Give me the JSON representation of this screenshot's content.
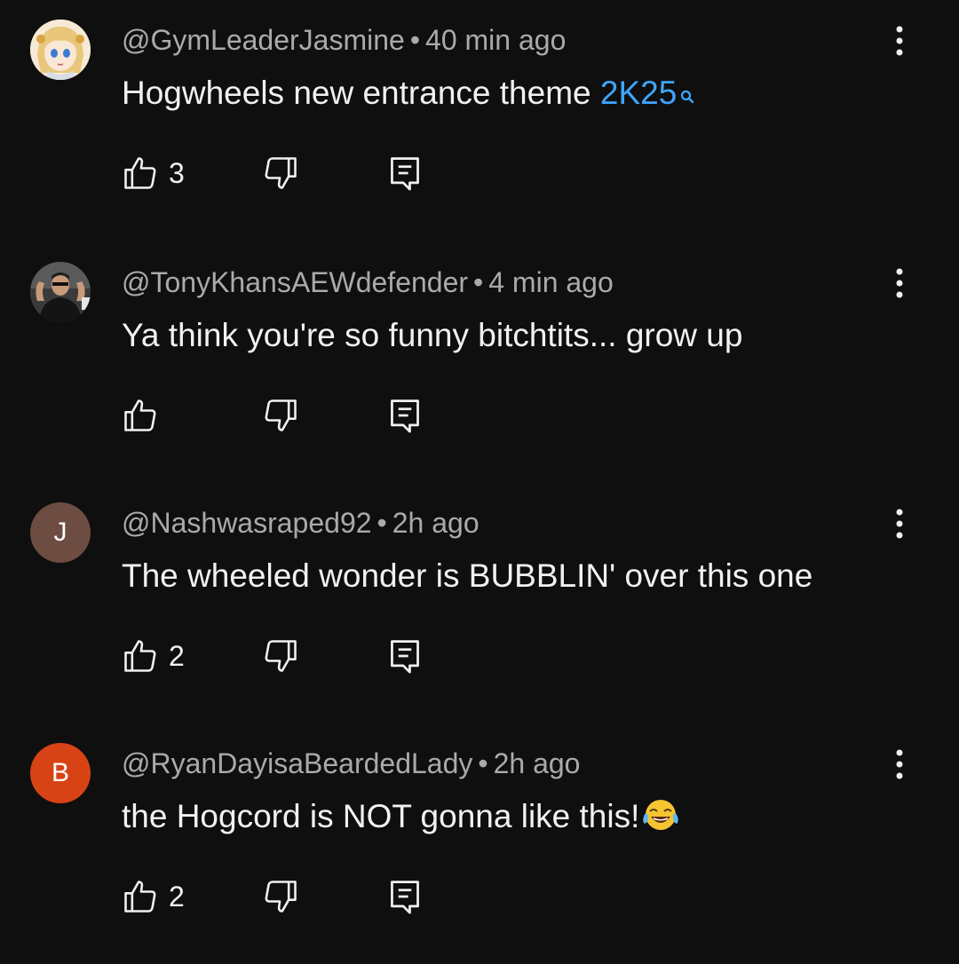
{
  "comments": [
    {
      "handle": "@GymLeaderJasmine",
      "time": "40 min ago",
      "text": "Hogwheels new entrance theme ",
      "link_text": "2K25",
      "likes": "3",
      "avatar": {
        "type": "image",
        "description_icon": "anime-girl-avatar"
      }
    },
    {
      "handle": "@TonyKhansAEWdefender",
      "time": "4 min ago",
      "text": "Ya think you're so funny bitchtits... grow up",
      "likes": "",
      "avatar": {
        "type": "image",
        "description_icon": "man-photo-avatar"
      }
    },
    {
      "handle": "@Nashwasraped92",
      "time": "2h ago",
      "text": "The wheeled wonder is BUBBLIN' over this one",
      "likes": "2",
      "avatar": {
        "type": "letter",
        "letter": "J",
        "color": "#6d4c41"
      }
    },
    {
      "handle": "@RyanDayisaBeardedLady",
      "time": "2h ago",
      "text": "the Hogcord is NOT gonna like this!",
      "likes": "2",
      "emoji": "face-with-tears-of-joy",
      "avatar": {
        "type": "letter",
        "letter": "B",
        "color": "#d84315"
      }
    }
  ],
  "separator": "•",
  "colors": {
    "background": "#0f0f0f",
    "text": "#f1f1f1",
    "meta": "#aaaaaa",
    "link": "#3ea6ff"
  }
}
